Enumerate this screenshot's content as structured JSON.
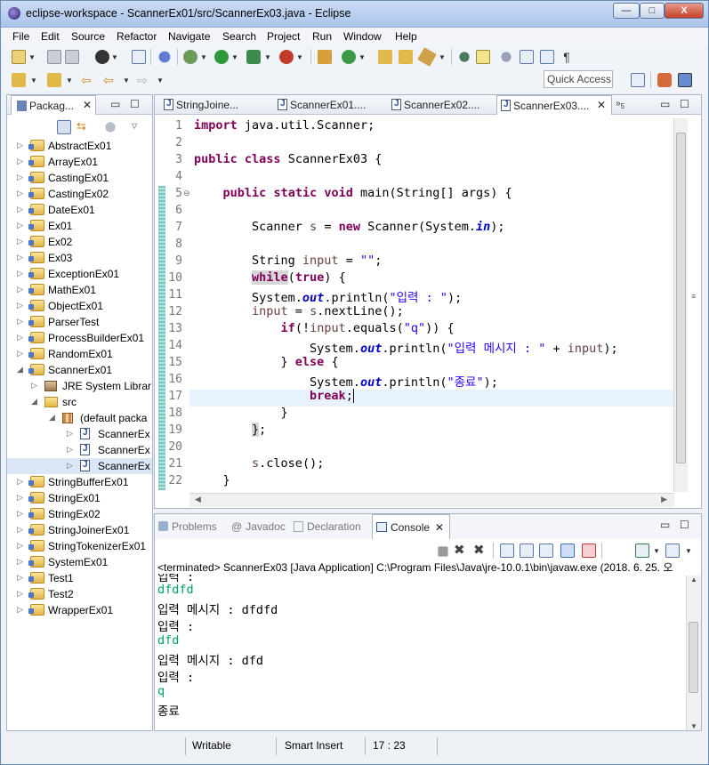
{
  "window": {
    "title": "eclipse-workspace - ScannerEx01/src/ScannerEx03.java - Eclipse",
    "controls": {
      "minimize": "—",
      "maximize": "□",
      "close": "X"
    }
  },
  "menu": [
    "File",
    "Edit",
    "Source",
    "Refactor",
    "Navigate",
    "Search",
    "Project",
    "Run",
    "Window",
    "Help"
  ],
  "toolbar": {
    "quick_access": "Quick Access"
  },
  "package_explorer": {
    "title": "Packag...",
    "items": [
      {
        "label": "AbstractEx01",
        "level": 0
      },
      {
        "label": "ArrayEx01",
        "level": 0
      },
      {
        "label": "CastingEx01",
        "level": 0
      },
      {
        "label": "CastingEx02",
        "level": 0
      },
      {
        "label": "DateEx01",
        "level": 0
      },
      {
        "label": "Ex01",
        "level": 0
      },
      {
        "label": "Ex02",
        "level": 0
      },
      {
        "label": "Ex03",
        "level": 0
      },
      {
        "label": "ExceptionEx01",
        "level": 0
      },
      {
        "label": "MathEx01",
        "level": 0
      },
      {
        "label": "ObjectEx01",
        "level": 0
      },
      {
        "label": "ParserTest",
        "level": 0
      },
      {
        "label": "ProcessBuilderEx01",
        "level": 0
      },
      {
        "label": "RandomEx01",
        "level": 0
      },
      {
        "label": "ScannerEx01",
        "level": 0,
        "expanded": true
      },
      {
        "label": "JRE System Librar",
        "level": 1
      },
      {
        "label": "src",
        "level": 1,
        "expanded": true
      },
      {
        "label": "(default packa",
        "level": 2,
        "expanded": true
      },
      {
        "label": "ScannerEx",
        "level": 3
      },
      {
        "label": "ScannerEx",
        "level": 3
      },
      {
        "label": "ScannerEx",
        "level": 3
      },
      {
        "label": "StringBufferEx01",
        "level": 0
      },
      {
        "label": "StringEx01",
        "level": 0
      },
      {
        "label": "StringEx02",
        "level": 0
      },
      {
        "label": "StringJoinerEx01",
        "level": 0
      },
      {
        "label": "StringTokenizerEx01",
        "level": 0
      },
      {
        "label": "SystemEx01",
        "level": 0
      },
      {
        "label": "Test1",
        "level": 0
      },
      {
        "label": "Test2",
        "level": 0
      },
      {
        "label": "WrapperEx01",
        "level": 0
      }
    ]
  },
  "editor": {
    "tabs": [
      "StringJoine...",
      "ScannerEx01....",
      "ScannerEx02....",
      "ScannerEx03...."
    ],
    "overflow": "5",
    "line_numbers": [
      "1",
      "2",
      "3",
      "4",
      "5",
      "6",
      "7",
      "8",
      "9",
      "10",
      "11",
      "12",
      "13",
      "14",
      "15",
      "16",
      "17",
      "18",
      "19",
      "20",
      "21",
      "22"
    ]
  },
  "bottom_panel": {
    "tabs": [
      "Problems",
      "Javadoc",
      "Declaration",
      "Console"
    ],
    "terminated": "<terminated> ScannerEx03 [Java Application] C:\\Program Files\\Java\\jre-10.0.1\\bin\\javaw.exe (2018. 6. 25. 오",
    "output": [
      {
        "text": "dfdfd",
        "input": true
      },
      {
        "text": "입력 메시지 : dfdfd",
        "input": false
      },
      {
        "text": "입력 :",
        "input": false
      },
      {
        "text": "dfd",
        "input": true
      },
      {
        "text": "입력 메시지 : dfd",
        "input": false
      },
      {
        "text": "입력 :",
        "input": false
      },
      {
        "text": "q",
        "input": true
      },
      {
        "text": "종료",
        "input": false
      }
    ],
    "partial_top": "입력 :"
  },
  "status": {
    "writable": "Writable",
    "insert_mode": "Smart Insert",
    "position": "17 : 23"
  }
}
